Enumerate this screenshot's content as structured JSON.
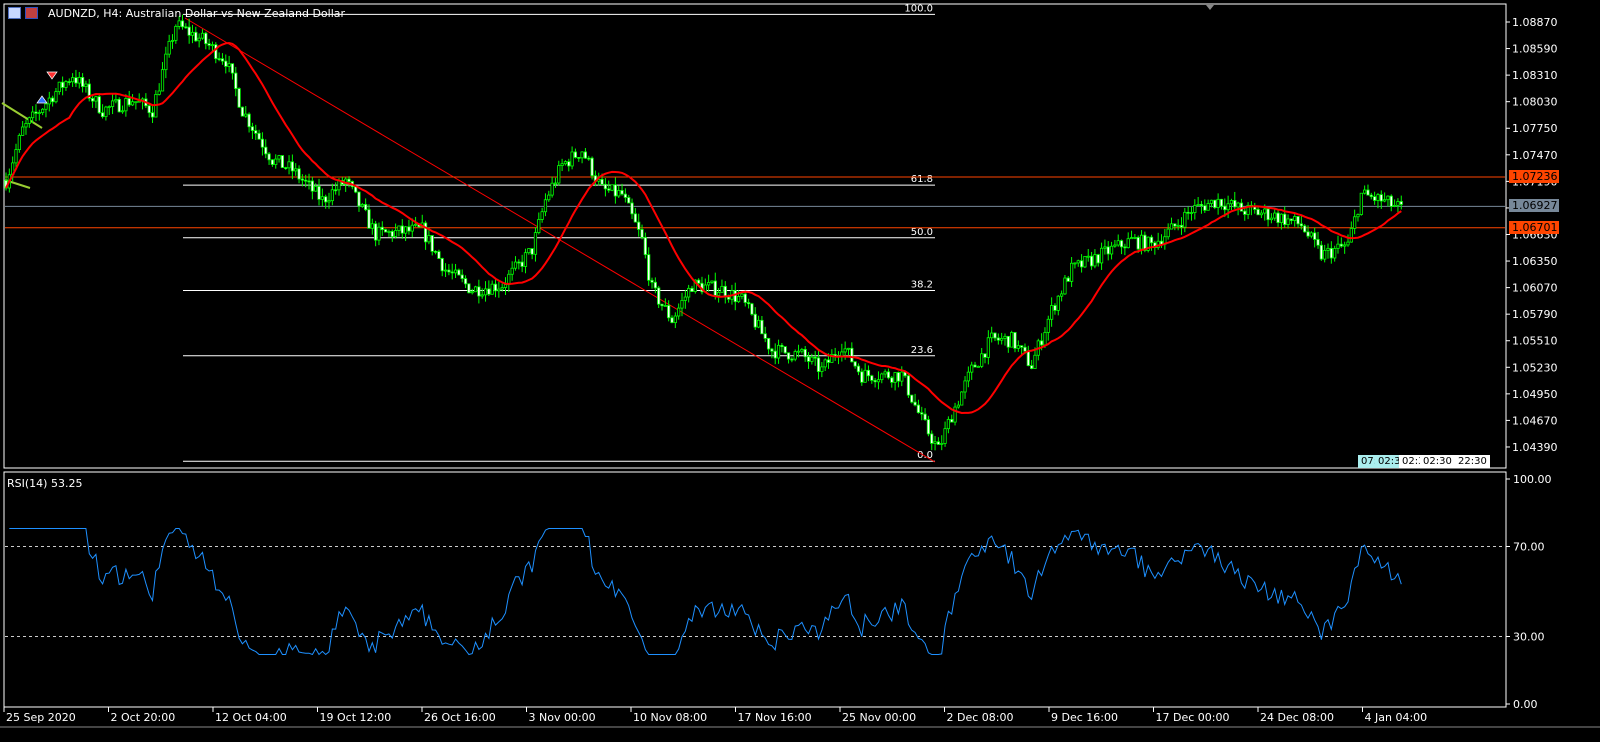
{
  "window": {
    "title": "AUDNZD, H4:  Australian Dollar vs New Zealand Dollar"
  },
  "price_axis": {
    "ticks": [
      "1.08870",
      "1.08590",
      "1.08310",
      "1.08030",
      "1.07750",
      "1.07470",
      "1.07190",
      "1.06910",
      "1.06630",
      "1.06350",
      "1.06070",
      "1.05790",
      "1.05510",
      "1.05230",
      "1.04950",
      "1.04670",
      "1.04390"
    ],
    "markers": [
      {
        "label": "1.07236",
        "price": 1.07236,
        "color": "#ff4500"
      },
      {
        "label": "1.06927",
        "price": 1.06927,
        "color": "#778899"
      },
      {
        "label": "1.06701",
        "price": 1.06701,
        "color": "#ff4500"
      }
    ]
  },
  "time_axis": {
    "labels": [
      "25 Sep 2020",
      "2 Oct 20:00",
      "12 Oct 04:00",
      "19 Oct 12:00",
      "26 Oct 16:00",
      "3 Nov 00:00",
      "10 Nov 08:00",
      "17 Nov 16:00",
      "25 Nov 00:00",
      "2 Dec 08:00",
      "9 Dec 16:00",
      "17 Dec 00:00",
      "24 Dec 08:00",
      "4 Jan 04:00"
    ]
  },
  "fibonacci": {
    "high": 1.0895,
    "low": 1.0424,
    "levels": [
      {
        "value": 1.0,
        "label": "100.0"
      },
      {
        "value": 0.618,
        "label": "61.8"
      },
      {
        "value": 0.5,
        "label": "50.0"
      },
      {
        "value": 0.382,
        "label": "38.2"
      },
      {
        "value": 0.236,
        "label": "23.6"
      },
      {
        "value": 0.0,
        "label": "0.0"
      }
    ]
  },
  "time_tags": [
    "07:",
    "02:3",
    "02:3",
    "02:30",
    "22:30"
  ],
  "rsi": {
    "label": "RSI(14) 53.25",
    "axis": [
      "100.00",
      "70.00",
      "30.00",
      "0.00"
    ],
    "levels": [
      70,
      30
    ],
    "color": "#1e90ff"
  },
  "colors": {
    "candle": "#00ff00",
    "ma": "#ff0000",
    "trendline": "#ff0000",
    "fib": "#ffffff"
  },
  "chart_data": {
    "type": "candlestick",
    "symbol": "AUDNZD",
    "timeframe": "H4",
    "bars": 420,
    "price_path": [
      [
        0,
        1.072
      ],
      [
        5,
        1.0773
      ],
      [
        14,
        1.081
      ],
      [
        20,
        1.0831
      ],
      [
        29,
        1.0794
      ],
      [
        38,
        1.0805
      ],
      [
        44,
        1.0794
      ],
      [
        48,
        1.0847
      ],
      [
        51,
        1.0884
      ],
      [
        59,
        1.0868
      ],
      [
        66,
        1.0847
      ],
      [
        71,
        1.0794
      ],
      [
        80,
        1.0742
      ],
      [
        86,
        1.0731
      ],
      [
        95,
        1.0699
      ],
      [
        102,
        1.072
      ],
      [
        111,
        1.0663
      ],
      [
        125,
        1.0668
      ],
      [
        132,
        1.0626
      ],
      [
        140,
        1.0605
      ],
      [
        149,
        1.061
      ],
      [
        158,
        1.0647
      ],
      [
        162,
        1.0699
      ],
      [
        167,
        1.0736
      ],
      [
        173,
        1.0752
      ],
      [
        179,
        1.071
      ],
      [
        185,
        1.0705
      ],
      [
        191,
        1.0657
      ],
      [
        194,
        1.0605
      ],
      [
        200,
        1.0573
      ],
      [
        206,
        1.061
      ],
      [
        215,
        1.0605
      ],
      [
        221,
        1.0594
      ],
      [
        230,
        1.0541
      ],
      [
        239,
        1.0536
      ],
      [
        245,
        1.052
      ],
      [
        251,
        1.0547
      ],
      [
        257,
        1.0515
      ],
      [
        269,
        1.0515
      ],
      [
        275,
        1.0467
      ],
      [
        280,
        1.0436
      ],
      [
        284,
        1.0473
      ],
      [
        290,
        1.052
      ],
      [
        296,
        1.0552
      ],
      [
        302,
        1.0552
      ],
      [
        308,
        1.0525
      ],
      [
        314,
        1.0583
      ],
      [
        320,
        1.0626
      ],
      [
        326,
        1.0636
      ],
      [
        332,
        1.0647
      ],
      [
        338,
        1.0657
      ],
      [
        344,
        1.0652
      ],
      [
        350,
        1.0668
      ],
      [
        356,
        1.0689
      ],
      [
        364,
        1.0699
      ],
      [
        371,
        1.0689
      ],
      [
        380,
        1.0684
      ],
      [
        389,
        1.0673
      ],
      [
        395,
        1.0641
      ],
      [
        403,
        1.0652
      ],
      [
        407,
        1.0705
      ],
      [
        413,
        1.0699
      ],
      [
        419,
        1.069
      ]
    ],
    "ma_period": 20,
    "rsi_period": 14,
    "rsi_last": 53.25
  }
}
